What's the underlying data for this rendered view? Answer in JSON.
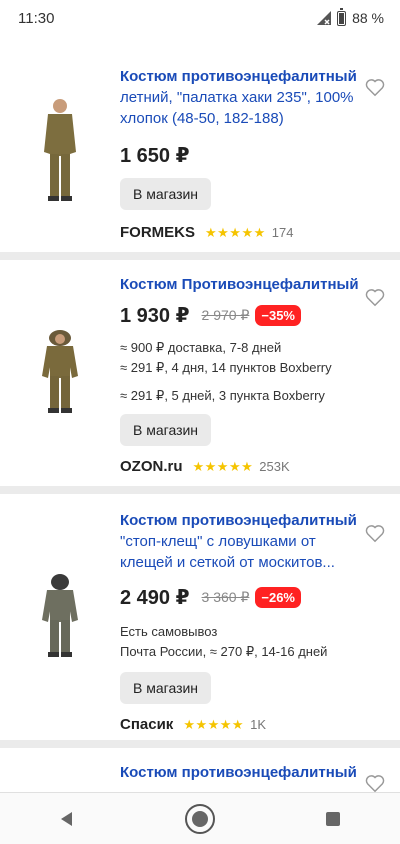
{
  "status": {
    "time": "11:30",
    "battery": "88 %"
  },
  "products": [
    {
      "title_lead": "Костюм противоэнцефалитный",
      "title_rest": "летний, \"палатка хаки 235\", 100% хлопок (48-50, 182-188)",
      "price": "1 650 ₽",
      "old_price": "",
      "discount": "",
      "delivery": [],
      "button": "В магазин",
      "shop": "FORMEKS",
      "stars": "★★★★★",
      "reviews": "174"
    },
    {
      "title_lead": "Костюм Противоэнцефалитный",
      "title_rest": "",
      "price": "1 930 ₽",
      "old_price": "2 970 ₽",
      "discount": "−35%",
      "delivery": [
        "≈ 900 ₽ доставка, 7-8 дней",
        "≈ 291 ₽, 4 дня, 14 пунктов Boxberry",
        "≈ 291 ₽, 5 дней, 3 пункта Boxberry"
      ],
      "button": "В магазин",
      "shop": "OZON.ru",
      "stars": "★★★★★",
      "reviews": "253K"
    },
    {
      "title_lead": "Костюм противоэнцефалитный",
      "title_rest": "\"стоп-клещ\" с ловушками от клещей и сеткой от москитов...",
      "price": "2 490 ₽",
      "old_price": "3 360 ₽",
      "discount": "−26%",
      "delivery": [
        "Есть самовывоз",
        "Почта России, ≈ 270 ₽, 14-16 дней"
      ],
      "button": "В магазин",
      "shop": "Спасик",
      "stars": "★★★★★",
      "reviews": "1K"
    },
    {
      "title_lead": "Костюм противоэнцефалитный"
    }
  ],
  "colors": {
    "link": "#1a4bb8",
    "discount": "#ff2222",
    "star": "#f5c400"
  },
  "icons": {
    "heart": "heart-icon",
    "back": "back-icon",
    "home": "home-icon",
    "recents": "recents-icon"
  }
}
